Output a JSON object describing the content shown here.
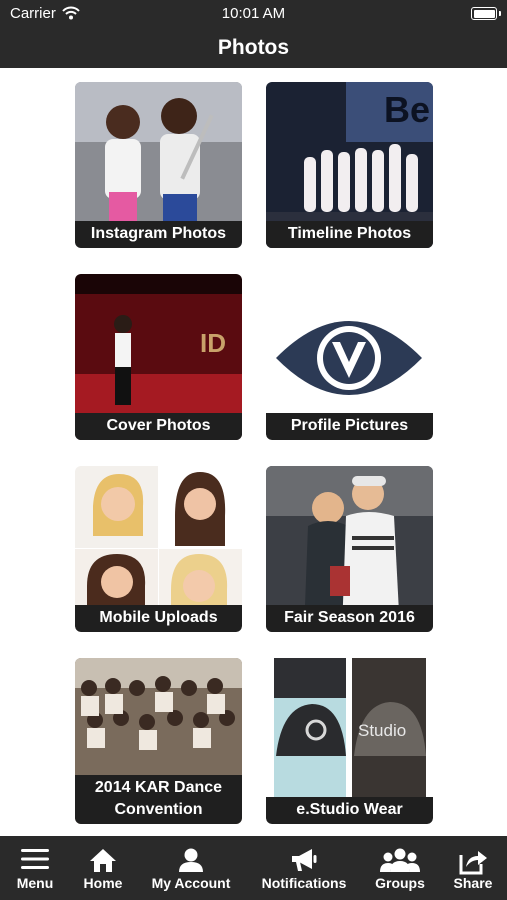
{
  "status": {
    "carrier": "Carrier",
    "time": "10:01 AM"
  },
  "header": {
    "title": "Photos"
  },
  "albums": [
    {
      "label": "Instagram Photos",
      "icon": "instagram-photo"
    },
    {
      "label": "Timeline Photos",
      "icon": "timeline-photo"
    },
    {
      "label": "Cover Photos",
      "icon": "cover-photo"
    },
    {
      "label": "Profile Pictures",
      "icon": "eye-logo"
    },
    {
      "label": "Mobile Uploads",
      "icon": "portrait-grid"
    },
    {
      "label": "Fair Season 2016",
      "icon": "fair-photo"
    },
    {
      "label": "2014 KAR Dance Convention",
      "icon": "group-photo"
    },
    {
      "label": "e.Studio Wear",
      "icon": "cap-photo"
    }
  ],
  "tabs": [
    {
      "label": "Menu",
      "icon": "menu-icon"
    },
    {
      "label": "Home",
      "icon": "home-icon"
    },
    {
      "label": "My Account",
      "icon": "user-icon"
    },
    {
      "label": "Notifications",
      "icon": "megaphone-icon"
    },
    {
      "label": "Groups",
      "icon": "group-icon"
    },
    {
      "label": "Share",
      "icon": "share-icon"
    }
  ],
  "colors": {
    "bar": "#2a2a2a",
    "caption": "#1f1f1f",
    "logo_navy": "#2c3a55"
  }
}
